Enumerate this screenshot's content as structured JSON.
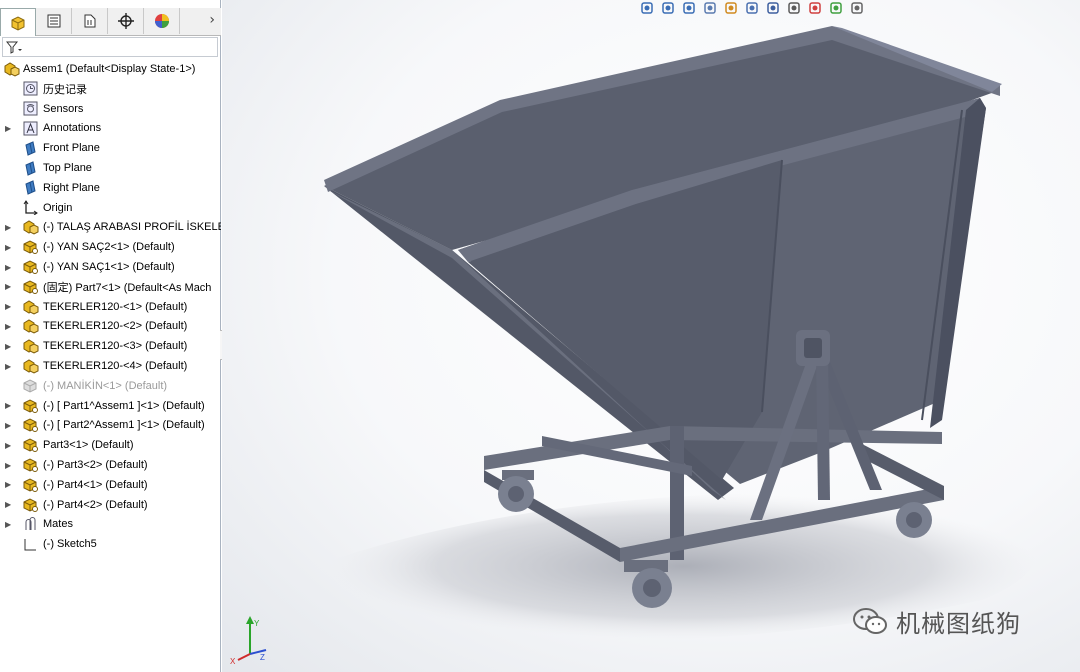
{
  "panel": {
    "tabs": [
      {
        "icon": "feature-manager-icon",
        "active": true
      },
      {
        "icon": "property-manager-icon",
        "active": false
      },
      {
        "icon": "configuration-manager-icon",
        "active": false
      },
      {
        "icon": "dimxpert-icon",
        "active": false
      },
      {
        "icon": "display-manager-icon",
        "active": false
      }
    ],
    "expand_glyph": "›",
    "filter_icon": "filter-icon"
  },
  "tree": {
    "root": {
      "label": "Assem1  (Default<Display State-1>)",
      "icon": "assembly-icon"
    },
    "items": [
      {
        "label": "历史记录",
        "icon": "history-icon",
        "arrow": false,
        "dim": false
      },
      {
        "label": "Sensors",
        "icon": "sensors-icon",
        "arrow": false,
        "dim": false
      },
      {
        "label": "Annotations",
        "icon": "annotations-icon",
        "arrow": true,
        "dim": false
      },
      {
        "label": "Front Plane",
        "icon": "plane-icon",
        "arrow": false,
        "dim": false
      },
      {
        "label": "Top Plane",
        "icon": "plane-icon",
        "arrow": false,
        "dim": false
      },
      {
        "label": "Right Plane",
        "icon": "plane-icon",
        "arrow": false,
        "dim": false
      },
      {
        "label": "Origin",
        "icon": "origin-icon",
        "arrow": false,
        "dim": false
      },
      {
        "label": "(-) TALAŞ ARABASI PROFİL İSKELE",
        "icon": "subassembly-icon",
        "arrow": true,
        "dim": false
      },
      {
        "label": "(-) YAN SAÇ2<1> (Default)",
        "icon": "part-icon",
        "arrow": true,
        "dim": false
      },
      {
        "label": "(-) YAN SAÇ1<1> (Default)",
        "icon": "part-icon",
        "arrow": true,
        "dim": false
      },
      {
        "label": "(固定) Part7<1> (Default<As Mach",
        "icon": "part-icon",
        "arrow": true,
        "dim": false
      },
      {
        "label": "TEKERLER120-<1> (Default)",
        "icon": "subassembly-icon",
        "arrow": true,
        "dim": false
      },
      {
        "label": "TEKERLER120-<2> (Default)",
        "icon": "subassembly-icon",
        "arrow": true,
        "dim": false
      },
      {
        "label": "TEKERLER120-<3> (Default)",
        "icon": "subassembly-icon",
        "arrow": true,
        "dim": false
      },
      {
        "label": "TEKERLER120-<4> (Default)",
        "icon": "subassembly-icon",
        "arrow": true,
        "dim": false
      },
      {
        "label": "(-) MANİKİN<1> (Default)",
        "icon": "suppressed-part-icon",
        "arrow": false,
        "dim": true
      },
      {
        "label": "(-) [ Part1^Assem1 ]<1> (Default)",
        "icon": "part-icon",
        "arrow": true,
        "dim": false
      },
      {
        "label": "(-) [ Part2^Assem1 ]<1> (Default)",
        "icon": "part-icon",
        "arrow": true,
        "dim": false
      },
      {
        "label": "Part3<1> (Default)",
        "icon": "part-icon",
        "arrow": true,
        "dim": false
      },
      {
        "label": "(-) Part3<2> (Default)",
        "icon": "part-icon",
        "arrow": true,
        "dim": false
      },
      {
        "label": "(-) Part4<1> (Default)",
        "icon": "part-icon",
        "arrow": true,
        "dim": false
      },
      {
        "label": "(-) Part4<2> (Default)",
        "icon": "part-icon",
        "arrow": true,
        "dim": false
      },
      {
        "label": "Mates",
        "icon": "mates-icon",
        "arrow": true,
        "dim": false
      },
      {
        "label": "(-) Sketch5",
        "icon": "sketch-icon",
        "arrow": false,
        "dim": false
      }
    ]
  },
  "view_toolbar": [
    "zoom-to-fit-icon",
    "zoom-to-area-icon",
    "previous-view-icon",
    "section-view-icon",
    "dynamic-annotation-icon",
    "view-orientation-icon",
    "display-style-icon",
    "hide-show-items-icon",
    "edit-appearance-icon",
    "apply-scene-icon",
    "view-settings-icon"
  ],
  "triad": {
    "x_label": "X",
    "y_label": "Y",
    "z_label": "Z"
  },
  "colors": {
    "model_body": "#5d6272",
    "model_dark": "#454a58",
    "model_light": "#7a8090",
    "shadow": "#b9bcc4",
    "tree_icon_yellow": "#e8b820",
    "plane_blue": "#3f7cc2"
  },
  "watermark": {
    "text": "机械图纸狗",
    "icon": "wechat-icon"
  }
}
